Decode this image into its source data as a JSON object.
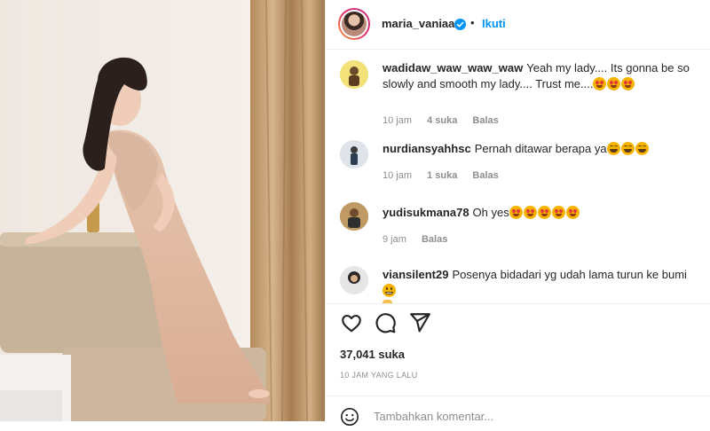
{
  "post": {
    "author": {
      "username": "maria_vaniaa",
      "follow_label": "Ikuti",
      "separator": "•"
    },
    "comments": [
      {
        "username": "wadidaw_waw_waw_waw",
        "text": "Yeah my lady.... Its gonna be so slowly and smooth my lady.... Trust me....",
        "emojis": [
          "star-struck",
          "star-struck",
          "star-struck"
        ],
        "time": "10 jam",
        "likes": "4 suka",
        "reply_label": "Balas"
      },
      {
        "username": "nurdiansyahhsc",
        "text": "Pernah ditawar berapa ya",
        "emojis": [
          "tears-of-joy",
          "tears-of-joy",
          "tears-of-joy"
        ],
        "time": "10 jam",
        "likes": "1 suka",
        "reply_label": "Balas"
      },
      {
        "username": "yudisukmana78",
        "text": "Oh yes",
        "emojis": [
          "star-struck",
          "star-struck",
          "star-struck",
          "star-struck",
          "star-struck"
        ],
        "time": "9 jam",
        "likes": "",
        "reply_label": "Balas"
      },
      {
        "username": "viansilent29",
        "text": "Posenya bidadari yg udah lama turun ke bumi",
        "emojis": [
          "grinning",
          "waving-hand"
        ],
        "time": "",
        "likes": "",
        "reply_label": ""
      }
    ],
    "likes_count": "37,041 suka",
    "posted_ago": "10 JAM YANG LALU",
    "comment_placeholder": "Tambahkan komentar..."
  },
  "icons": {
    "like": "heart-icon",
    "comment": "comment-bubble-icon",
    "share": "paper-plane-icon",
    "verified": "verified-badge-icon",
    "emoji_picker": "smiley-icon"
  },
  "colors": {
    "accent": "#0095f6",
    "text": "#262626",
    "muted": "#8e8e8e",
    "divider": "#efefef"
  }
}
